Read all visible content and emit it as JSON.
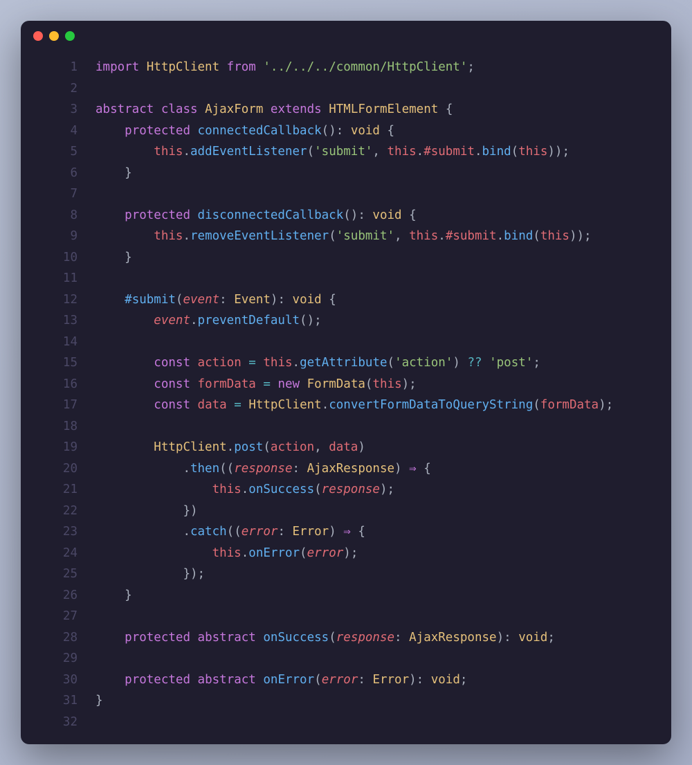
{
  "window": {
    "traffic_lights": [
      "close",
      "minimize",
      "zoom"
    ]
  },
  "editor": {
    "line_count": 32,
    "lines": [
      {
        "n": "1",
        "t": [
          [
            "kw",
            "import"
          ],
          [
            "txt",
            " "
          ],
          [
            "cls",
            "HttpClient"
          ],
          [
            "txt",
            " "
          ],
          [
            "kw",
            "from"
          ],
          [
            "txt",
            " "
          ],
          [
            "str",
            "'../../../common/HttpClient'"
          ],
          [
            "pun",
            ";"
          ]
        ]
      },
      {
        "n": "2",
        "t": []
      },
      {
        "n": "3",
        "t": [
          [
            "kw",
            "abstract"
          ],
          [
            "txt",
            " "
          ],
          [
            "kw",
            "class"
          ],
          [
            "txt",
            " "
          ],
          [
            "cls",
            "AjaxForm"
          ],
          [
            "txt",
            " "
          ],
          [
            "kw",
            "extends"
          ],
          [
            "txt",
            " "
          ],
          [
            "cls",
            "HTMLFormElement"
          ],
          [
            "txt",
            " "
          ],
          [
            "pun",
            "{"
          ]
        ]
      },
      {
        "n": "4",
        "t": [
          [
            "txt",
            "    "
          ],
          [
            "kw",
            "protected"
          ],
          [
            "txt",
            " "
          ],
          [
            "fn",
            "connectedCallback"
          ],
          [
            "pun",
            "():"
          ],
          [
            "txt",
            " "
          ],
          [
            "type",
            "void"
          ],
          [
            "txt",
            " "
          ],
          [
            "pun",
            "{"
          ]
        ]
      },
      {
        "n": "5",
        "t": [
          [
            "txt",
            "        "
          ],
          [
            "var",
            "this"
          ],
          [
            "pun",
            "."
          ],
          [
            "fn",
            "addEventListener"
          ],
          [
            "pun",
            "("
          ],
          [
            "str",
            "'submit'"
          ],
          [
            "pun",
            ", "
          ],
          [
            "var",
            "this"
          ],
          [
            "pun",
            "."
          ],
          [
            "var",
            "#submit"
          ],
          [
            "pun",
            "."
          ],
          [
            "fn",
            "bind"
          ],
          [
            "pun",
            "("
          ],
          [
            "var",
            "this"
          ],
          [
            "pun",
            "));"
          ]
        ]
      },
      {
        "n": "6",
        "t": [
          [
            "txt",
            "    "
          ],
          [
            "pun",
            "}"
          ]
        ]
      },
      {
        "n": "7",
        "t": []
      },
      {
        "n": "8",
        "t": [
          [
            "txt",
            "    "
          ],
          [
            "kw",
            "protected"
          ],
          [
            "txt",
            " "
          ],
          [
            "fn",
            "disconnectedCallback"
          ],
          [
            "pun",
            "():"
          ],
          [
            "txt",
            " "
          ],
          [
            "type",
            "void"
          ],
          [
            "txt",
            " "
          ],
          [
            "pun",
            "{"
          ]
        ]
      },
      {
        "n": "9",
        "t": [
          [
            "txt",
            "        "
          ],
          [
            "var",
            "this"
          ],
          [
            "pun",
            "."
          ],
          [
            "fn",
            "removeEventListener"
          ],
          [
            "pun",
            "("
          ],
          [
            "str",
            "'submit'"
          ],
          [
            "pun",
            ", "
          ],
          [
            "var",
            "this"
          ],
          [
            "pun",
            "."
          ],
          [
            "var",
            "#submit"
          ],
          [
            "pun",
            "."
          ],
          [
            "fn",
            "bind"
          ],
          [
            "pun",
            "("
          ],
          [
            "var",
            "this"
          ],
          [
            "pun",
            "));"
          ]
        ]
      },
      {
        "n": "10",
        "t": [
          [
            "txt",
            "    "
          ],
          [
            "pun",
            "}"
          ]
        ]
      },
      {
        "n": "11",
        "t": []
      },
      {
        "n": "12",
        "t": [
          [
            "txt",
            "    "
          ],
          [
            "fn",
            "#submit"
          ],
          [
            "pun",
            "("
          ],
          [
            "param",
            "event"
          ],
          [
            "pun",
            ": "
          ],
          [
            "cls",
            "Event"
          ],
          [
            "pun",
            "):"
          ],
          [
            "txt",
            " "
          ],
          [
            "type",
            "void"
          ],
          [
            "txt",
            " "
          ],
          [
            "pun",
            "{"
          ]
        ]
      },
      {
        "n": "13",
        "t": [
          [
            "txt",
            "        "
          ],
          [
            "param",
            "event"
          ],
          [
            "pun",
            "."
          ],
          [
            "fn",
            "preventDefault"
          ],
          [
            "pun",
            "();"
          ]
        ]
      },
      {
        "n": "14",
        "t": []
      },
      {
        "n": "15",
        "t": [
          [
            "txt",
            "        "
          ],
          [
            "kw",
            "const"
          ],
          [
            "txt",
            " "
          ],
          [
            "var",
            "action"
          ],
          [
            "txt",
            " "
          ],
          [
            "op",
            "="
          ],
          [
            "txt",
            " "
          ],
          [
            "var",
            "this"
          ],
          [
            "pun",
            "."
          ],
          [
            "fn",
            "getAttribute"
          ],
          [
            "pun",
            "("
          ],
          [
            "str",
            "'action'"
          ],
          [
            "pun",
            ")"
          ],
          [
            "txt",
            " "
          ],
          [
            "op",
            "??"
          ],
          [
            "txt",
            " "
          ],
          [
            "str",
            "'post'"
          ],
          [
            "pun",
            ";"
          ]
        ]
      },
      {
        "n": "16",
        "t": [
          [
            "txt",
            "        "
          ],
          [
            "kw",
            "const"
          ],
          [
            "txt",
            " "
          ],
          [
            "var",
            "formData"
          ],
          [
            "txt",
            " "
          ],
          [
            "op",
            "="
          ],
          [
            "txt",
            " "
          ],
          [
            "kw",
            "new"
          ],
          [
            "txt",
            " "
          ],
          [
            "cls",
            "FormData"
          ],
          [
            "pun",
            "("
          ],
          [
            "var",
            "this"
          ],
          [
            "pun",
            ");"
          ]
        ]
      },
      {
        "n": "17",
        "t": [
          [
            "txt",
            "        "
          ],
          [
            "kw",
            "const"
          ],
          [
            "txt",
            " "
          ],
          [
            "var",
            "data"
          ],
          [
            "txt",
            " "
          ],
          [
            "op",
            "="
          ],
          [
            "txt",
            " "
          ],
          [
            "cls",
            "HttpClient"
          ],
          [
            "pun",
            "."
          ],
          [
            "fn",
            "convertFormDataToQueryString"
          ],
          [
            "pun",
            "("
          ],
          [
            "var",
            "formData"
          ],
          [
            "pun",
            ");"
          ]
        ]
      },
      {
        "n": "18",
        "t": []
      },
      {
        "n": "19",
        "t": [
          [
            "txt",
            "        "
          ],
          [
            "cls",
            "HttpClient"
          ],
          [
            "pun",
            "."
          ],
          [
            "fn",
            "post"
          ],
          [
            "pun",
            "("
          ],
          [
            "var",
            "action"
          ],
          [
            "pun",
            ", "
          ],
          [
            "var",
            "data"
          ],
          [
            "pun",
            ")"
          ]
        ]
      },
      {
        "n": "20",
        "t": [
          [
            "txt",
            "            "
          ],
          [
            "pun",
            "."
          ],
          [
            "fn",
            "then"
          ],
          [
            "pun",
            "(("
          ],
          [
            "param",
            "response"
          ],
          [
            "pun",
            ": "
          ],
          [
            "cls",
            "AjaxResponse"
          ],
          [
            "pun",
            ")"
          ],
          [
            "txt",
            " "
          ],
          [
            "kw",
            "⇒"
          ],
          [
            "txt",
            " "
          ],
          [
            "pun",
            "{"
          ]
        ]
      },
      {
        "n": "21",
        "t": [
          [
            "txt",
            "                "
          ],
          [
            "var",
            "this"
          ],
          [
            "pun",
            "."
          ],
          [
            "fn",
            "onSuccess"
          ],
          [
            "pun",
            "("
          ],
          [
            "param",
            "response"
          ],
          [
            "pun",
            ");"
          ]
        ]
      },
      {
        "n": "22",
        "t": [
          [
            "txt",
            "            "
          ],
          [
            "pun",
            "})"
          ]
        ]
      },
      {
        "n": "23",
        "t": [
          [
            "txt",
            "            "
          ],
          [
            "pun",
            "."
          ],
          [
            "fn",
            "catch"
          ],
          [
            "pun",
            "(("
          ],
          [
            "param",
            "error"
          ],
          [
            "pun",
            ": "
          ],
          [
            "cls",
            "Error"
          ],
          [
            "pun",
            ")"
          ],
          [
            "txt",
            " "
          ],
          [
            "kw",
            "⇒"
          ],
          [
            "txt",
            " "
          ],
          [
            "pun",
            "{"
          ]
        ]
      },
      {
        "n": "24",
        "t": [
          [
            "txt",
            "                "
          ],
          [
            "var",
            "this"
          ],
          [
            "pun",
            "."
          ],
          [
            "fn",
            "onError"
          ],
          [
            "pun",
            "("
          ],
          [
            "param",
            "error"
          ],
          [
            "pun",
            ");"
          ]
        ]
      },
      {
        "n": "25",
        "t": [
          [
            "txt",
            "            "
          ],
          [
            "pun",
            "});"
          ]
        ]
      },
      {
        "n": "26",
        "t": [
          [
            "txt",
            "    "
          ],
          [
            "pun",
            "}"
          ]
        ]
      },
      {
        "n": "27",
        "t": []
      },
      {
        "n": "28",
        "t": [
          [
            "txt",
            "    "
          ],
          [
            "kw",
            "protected"
          ],
          [
            "txt",
            " "
          ],
          [
            "kw",
            "abstract"
          ],
          [
            "txt",
            " "
          ],
          [
            "fn",
            "onSuccess"
          ],
          [
            "pun",
            "("
          ],
          [
            "param",
            "response"
          ],
          [
            "pun",
            ": "
          ],
          [
            "cls",
            "AjaxResponse"
          ],
          [
            "pun",
            "):"
          ],
          [
            "txt",
            " "
          ],
          [
            "type",
            "void"
          ],
          [
            "pun",
            ";"
          ]
        ]
      },
      {
        "n": "29",
        "t": []
      },
      {
        "n": "30",
        "t": [
          [
            "txt",
            "    "
          ],
          [
            "kw",
            "protected"
          ],
          [
            "txt",
            " "
          ],
          [
            "kw",
            "abstract"
          ],
          [
            "txt",
            " "
          ],
          [
            "fn",
            "onError"
          ],
          [
            "pun",
            "("
          ],
          [
            "param",
            "error"
          ],
          [
            "pun",
            ": "
          ],
          [
            "cls",
            "Error"
          ],
          [
            "pun",
            "):"
          ],
          [
            "txt",
            " "
          ],
          [
            "type",
            "void"
          ],
          [
            "pun",
            ";"
          ]
        ]
      },
      {
        "n": "31",
        "t": [
          [
            "pun",
            "}"
          ]
        ]
      },
      {
        "n": "32",
        "t": []
      }
    ]
  }
}
